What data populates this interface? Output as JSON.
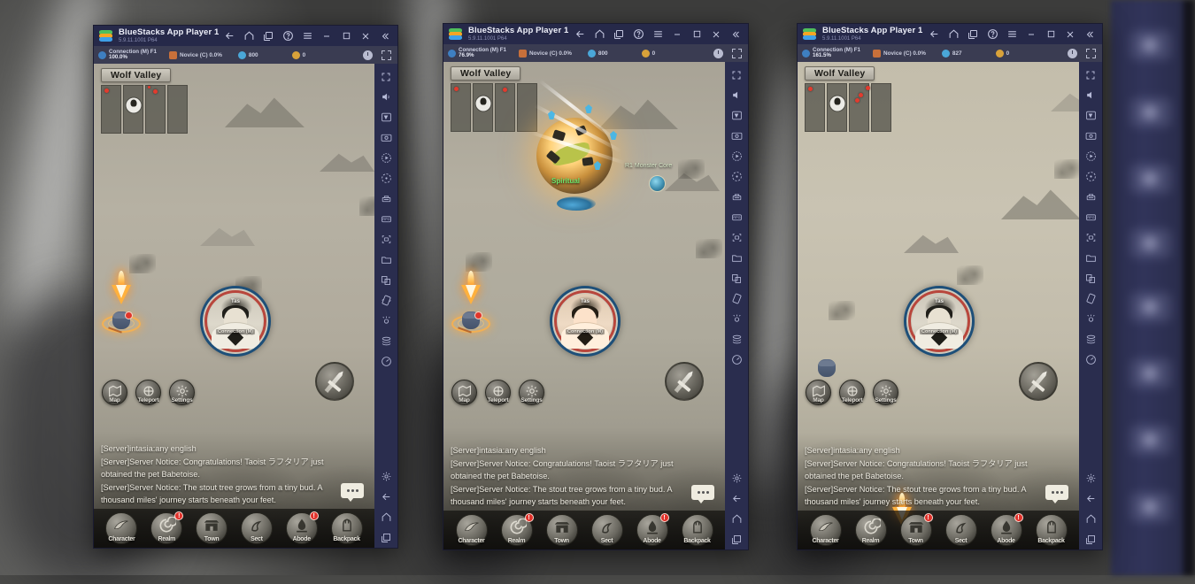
{
  "background": {
    "description": "blurred desktop wallpaper behind windows"
  },
  "windows": [
    {
      "id": "window-1",
      "titlebar": {
        "logo": "bluestacks-logo",
        "app_name": "BlueStacks App Player 1",
        "version": "5.9.11.1001  P64",
        "buttons": [
          {
            "name": "back-button",
            "icon": "arrow-left-icon"
          },
          {
            "name": "home-button",
            "icon": "home-icon"
          },
          {
            "name": "multi-instance-button",
            "icon": "copy-icon"
          },
          {
            "name": "help-button",
            "icon": "question-circle-icon"
          },
          {
            "name": "menu-button",
            "icon": "hamburger-icon"
          },
          {
            "name": "minimize-button",
            "icon": "minimize-icon"
          },
          {
            "name": "maximize-button",
            "icon": "maximize-icon"
          },
          {
            "name": "close-button",
            "icon": "close-icon"
          },
          {
            "name": "collapse-sidebar-button",
            "icon": "chevron-double-left-icon"
          }
        ]
      },
      "stats": {
        "connection_label": "Connection (M) F1",
        "connection_value": "100.0%",
        "rank_label": "Novice (C) 0.0%",
        "gems": "800",
        "coins": "0",
        "clock_icon": "clock-icon",
        "fullscreen_icon": "fullscreen-icon"
      },
      "game": {
        "zone_name": "Wolf Valley",
        "portrait": {
          "top_name": "Tas",
          "bottom_name": "Connection (M)"
        },
        "actions": [
          {
            "label": "Map",
            "icon": "map-icon"
          },
          {
            "label": "Teleport",
            "icon": "teleport-icon"
          },
          {
            "label": "Settings",
            "icon": "settings-icon"
          }
        ],
        "attack_button": "sword-icon",
        "chat_lines": [
          "[Server]intasia:any english",
          "[Server]Server Notice: Congratulations! Taoist ラフタリア just obtained the pet Babetoise.",
          "[Server]Server Notice: The stout tree grows from a tiny bud. A thousand miles' journey starts beneath your feet."
        ],
        "chat_more": "...",
        "bottom_nav": [
          {
            "label": "Character",
            "icon": "character-icon",
            "alert": false
          },
          {
            "label": "Realm",
            "icon": "realm-spiral-icon",
            "alert": true
          },
          {
            "label": "Town",
            "icon": "town-gate-icon",
            "alert": false
          },
          {
            "label": "Sect",
            "icon": "sect-dragon-icon",
            "alert": false
          },
          {
            "label": "Abode",
            "icon": "abode-icon",
            "alert": true
          },
          {
            "label": "Backpack",
            "icon": "backpack-icon",
            "alert": false
          }
        ],
        "floating_labels": []
      },
      "sidebar": [
        {
          "name": "fullscreen-icon"
        },
        {
          "name": "volume-icon"
        },
        {
          "name": "keymapping-icon"
        },
        {
          "name": "screenshot-icon"
        },
        {
          "name": "record-icon"
        },
        {
          "name": "macro-icon"
        },
        {
          "name": "eco-mode-icon"
        },
        {
          "name": "rpg-mode-icon"
        },
        {
          "name": "scan-icon"
        },
        {
          "name": "media-folder-icon"
        },
        {
          "name": "multi-instance-icon"
        },
        {
          "name": "rotate-icon"
        },
        {
          "name": "shake-icon"
        },
        {
          "name": "layers-icon"
        },
        {
          "name": "location-icon"
        },
        {
          "name": "gear-icon"
        },
        {
          "name": "back-icon"
        },
        {
          "name": "home-icon"
        },
        {
          "name": "recents-icon"
        }
      ]
    },
    {
      "id": "window-2",
      "titlebar": {
        "app_name": "BlueStacks App Player 1",
        "version": "5.9.11.1001  P64"
      },
      "stats": {
        "connection_label": "Connection (M) F1",
        "connection_value": "76.9%",
        "rank_label": "Novice (C) 0.0%",
        "gems": "800",
        "coins": "0"
      },
      "game": {
        "zone_name": "Wolf Valley",
        "portrait": {
          "top_name": "Tas",
          "bottom_name": "Connection (M)"
        },
        "floating_labels": [
          {
            "text": "Spiritual",
            "kind": "player-name"
          },
          {
            "text": "R1 Monster Core",
            "kind": "item-drop"
          }
        ]
      }
    },
    {
      "id": "window-3",
      "titlebar": {
        "app_name": "BlueStacks App Player 1",
        "version": "5.9.11.1001  P64"
      },
      "stats": {
        "connection_label": "Connection (M) F1",
        "connection_value": "161.5%",
        "rank_label": "Novice (C) 0.0%",
        "gems": "827",
        "coins": "0"
      },
      "game": {
        "zone_name": "Wolf Valley",
        "portrait": {
          "top_name": "Tas",
          "bottom_name": "Connection (M)"
        }
      }
    }
  ],
  "colors": {
    "titlebar_bg": "#262949",
    "stats_bg": "#3a3c52",
    "sidebar_bg": "#2a2d4e",
    "accent_red": "#e0312a",
    "accent_orange": "#ffb13d",
    "game_paper": "#b7b2a3"
  }
}
